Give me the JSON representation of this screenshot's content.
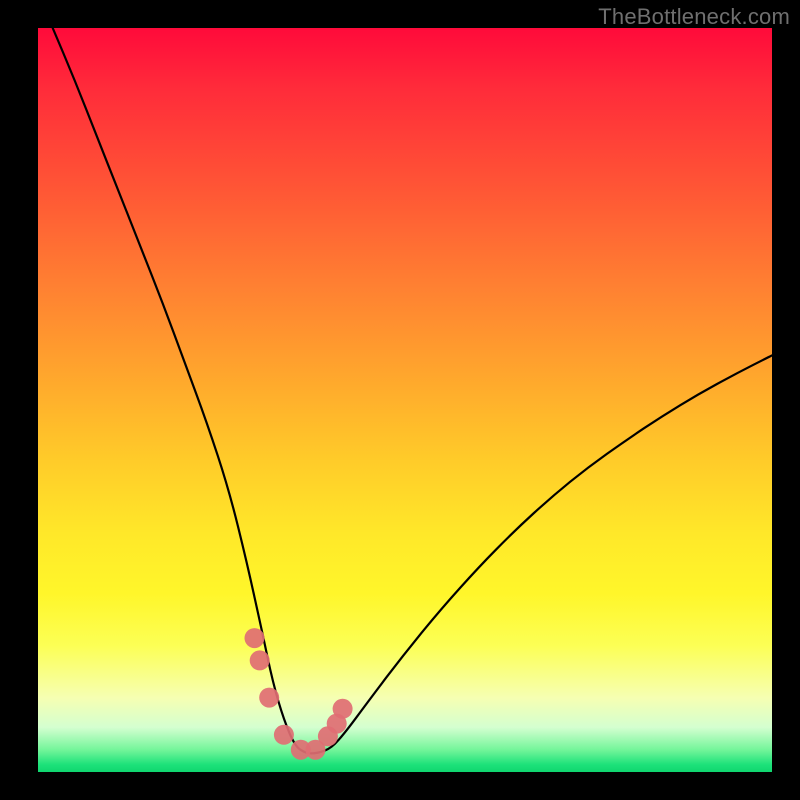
{
  "watermark": "TheBottleneck.com",
  "chart_data": {
    "type": "line",
    "title": "",
    "xlabel": "",
    "ylabel": "",
    "xlim": [
      0,
      100
    ],
    "ylim": [
      0,
      100
    ],
    "series": [
      {
        "name": "bottleneck-curve",
        "x": [
          2,
          5,
          8,
          11,
          14,
          17,
          20,
          23,
          26,
          28.5,
          30.5,
          32,
          33.5,
          35,
          36.5,
          38,
          40,
          42,
          45,
          50,
          55,
          60,
          65,
          70,
          75,
          80,
          85,
          90,
          95,
          100
        ],
        "values": [
          100,
          93,
          85.5,
          78,
          70.5,
          63,
          55,
          47,
          38,
          28,
          19,
          12,
          7,
          3.5,
          2.5,
          2.5,
          3.2,
          5.5,
          9.5,
          16,
          22,
          27.5,
          32.5,
          37,
          41,
          44.5,
          47.8,
          50.8,
          53.5,
          56
        ]
      }
    ],
    "markers": {
      "name": "highlight-points",
      "color": "#e06e73",
      "radius_px": 10,
      "x": [
        29.5,
        30.2,
        31.5,
        33.5,
        35.8,
        37.8,
        39.5,
        40.7,
        41.5
      ],
      "values": [
        18,
        15,
        10,
        5,
        3,
        3,
        4.8,
        6.5,
        8.5
      ]
    },
    "background_gradient": {
      "orientation": "vertical",
      "stops": [
        {
          "pos": 0.0,
          "color": "#ff0a3a"
        },
        {
          "pos": 0.34,
          "color": "#ff7e32"
        },
        {
          "pos": 0.68,
          "color": "#ffe829"
        },
        {
          "pos": 0.9,
          "color": "#f6ffb2"
        },
        {
          "pos": 1.0,
          "color": "#0fd66f"
        }
      ]
    }
  }
}
